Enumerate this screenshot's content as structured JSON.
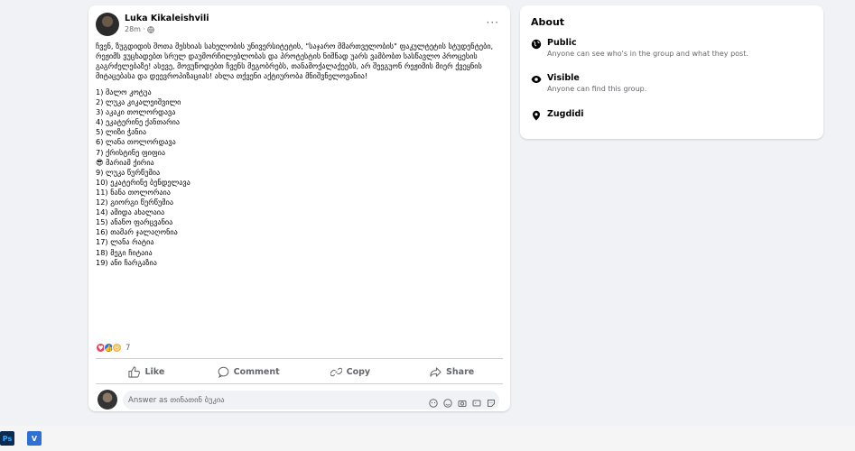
{
  "post": {
    "author": "Luka Kikaleishvili",
    "time": "28m ·",
    "more": "···",
    "intro": "ჩვენ, ზუგდიდის შოთა მესხიას სახელობის უნივერსიტეტის, \"საჯარო მმართველობის\" ფაკულტეტის სტუდენტები, რეჟიმს ვუცხადებთ სრულ დაუმორჩილებლობას და პროტესტის ნიშნად უარს ვამბობთ სასწავლო პროცესის გაგრძელებაზე! ასევე, მოვუწოდებთ ჩვენს მეგობრებს, თანამოქალაქეებს, არ შეეგუონ რეჟიმის მიერ ქვეყნის მიტაცებასა და დეევროპიზაციას! ახლა თქვენი აქტიურობა მნიშვნელოვანია!",
    "list": [
      "1) მალო კოტუა",
      "2) ლუკა კიკალეიშვილი",
      "3) აკაკი თოლორდავა",
      "4) ეკატერინე ქანთარია",
      "5) ლიზი ჭანია",
      "6) ლანა თოლორდავა",
      "7) ქრისტინე ფიფია",
      "😎 მარიამ ქირია",
      "9) ლუკა წურწუმია",
      "10) ეკატერინე ბენდელავა",
      "11) ნანა თოლორაია",
      "12) გიორგი წურწუმია",
      "14) ამიდა ახალაია",
      "15) ანანო ფარცვანია",
      "16)  თამარ ჯალაღონია",
      "17) ლანა რატია",
      "18) მეგი ჩიტაია",
      "19) ანი ჩარგაზია"
    ],
    "reaction_count": "7",
    "actions": {
      "like": "Like",
      "comment": "Comment",
      "copy": "Copy",
      "share": "Share"
    },
    "comment_placeholder": "Answer as თინათინ ბუკია"
  },
  "about": {
    "title": "About",
    "public_title": "Public",
    "public_desc": "Anyone can see who's in the group and what they post.",
    "visible_title": "Visible",
    "visible_desc": "Anyone can find this group.",
    "location": "Zugdidi"
  },
  "taskbar": {
    "ps": "Ps",
    "v": "V"
  },
  "colors": {
    "like_blue": "#1877f2",
    "love_red": "#f33e58",
    "haha_yellow": "#f7b125",
    "bg": "#f0f2f5",
    "muted": "#65676b"
  }
}
